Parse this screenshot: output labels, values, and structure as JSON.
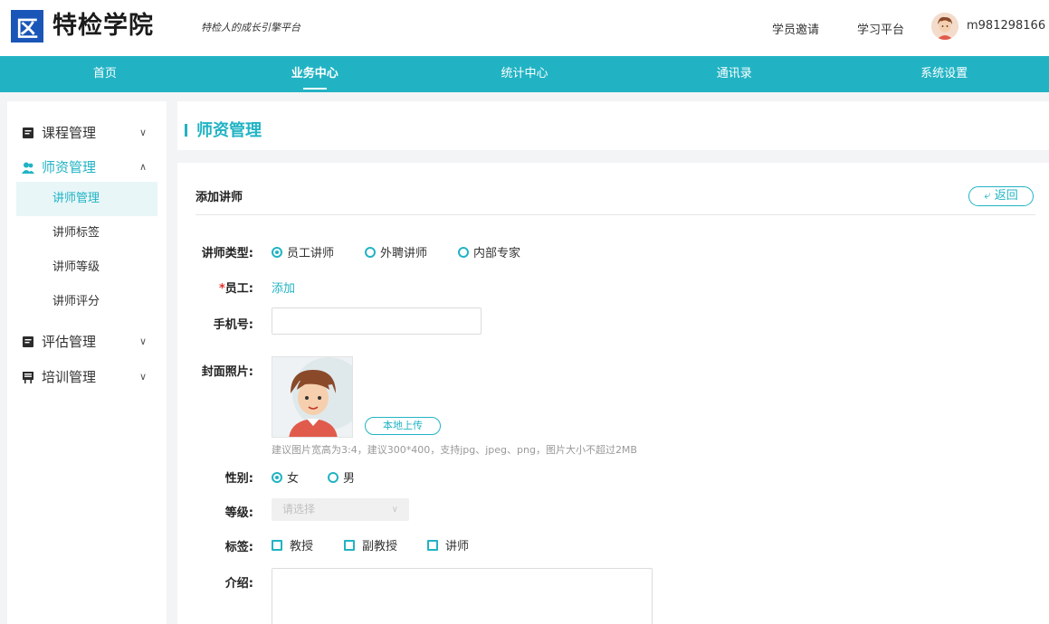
{
  "header": {
    "logo_glyph": "区",
    "brand": "特检学院",
    "slogan": "特检人的成长引擎平台",
    "links": [
      "学员邀请",
      "学习平台"
    ],
    "username": "m981298166"
  },
  "nav": {
    "items": [
      "首页",
      "业务中心",
      "统计中心",
      "通讯录",
      "系统设置"
    ],
    "active": "业务中心"
  },
  "sidebar": {
    "groups": [
      {
        "label": "课程管理",
        "icon": "book-icon",
        "expanded": false
      },
      {
        "label": "师资管理",
        "icon": "teacher-icon",
        "expanded": true,
        "children": [
          "讲师管理",
          "讲师标签",
          "讲师等级",
          "讲师评分"
        ],
        "active": "讲师管理"
      },
      {
        "label": "评估管理",
        "icon": "book-icon",
        "expanded": false
      },
      {
        "label": "培训管理",
        "icon": "training-icon",
        "expanded": false
      }
    ]
  },
  "page": {
    "title": "师资管理",
    "panel_title": "添加讲师",
    "back_label": "返回"
  },
  "form": {
    "teacher_type": {
      "label": "讲师类型:",
      "options": [
        "员工讲师",
        "外聘讲师",
        "内部专家"
      ],
      "selected": "员工讲师"
    },
    "employee": {
      "required_mark": "*",
      "label": "员工:",
      "action": "添加"
    },
    "phone": {
      "label": "手机号:",
      "value": ""
    },
    "cover": {
      "label": "封面照片:",
      "upload_label": "本地上传",
      "hint": "建议图片宽高为3:4，建议300*400，支持jpg、jpeg、png，图片大小不超过2MB"
    },
    "gender": {
      "label": "性别:",
      "options": [
        "女",
        "男"
      ],
      "selected": "女"
    },
    "level": {
      "label": "等级:",
      "placeholder": "请选择"
    },
    "tags": {
      "label": "标签:",
      "options": [
        "教授",
        "副教授",
        "讲师"
      ],
      "checked": []
    },
    "intro": {
      "label": "介绍:",
      "value": ""
    }
  },
  "colors": {
    "accent": "#21b3c4",
    "brand_blue": "#1a56b8",
    "required": "#e5322d"
  }
}
